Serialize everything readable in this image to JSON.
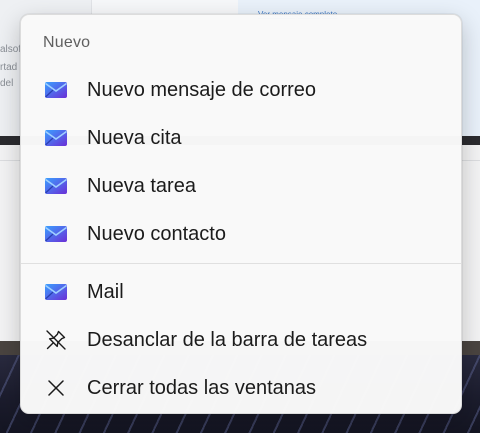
{
  "background": {
    "link_text": "Ver mensaje completo",
    "side_lines": [
      "alsof",
      "rtad",
      "del"
    ]
  },
  "menu": {
    "header": "Nuevo",
    "tasks": [
      {
        "label": "Nuevo mensaje de correo",
        "icon": "mail-app-icon"
      },
      {
        "label": "Nueva cita",
        "icon": "mail-app-icon"
      },
      {
        "label": "Nueva tarea",
        "icon": "mail-app-icon"
      },
      {
        "label": "Nuevo contacto",
        "icon": "mail-app-icon"
      }
    ],
    "app": {
      "label": "Mail",
      "icon": "mail-app-icon"
    },
    "unpin": {
      "label": "Desanclar de la barra de tareas",
      "icon": "unpin-icon"
    },
    "close_all": {
      "label": "Cerrar todas las ventanas",
      "icon": "close-icon"
    }
  },
  "colors": {
    "menu_bg": "#f9f9f9",
    "text": "#1b1b1b",
    "header_text": "#5f5f5f",
    "mail_icon_blue": "#2f6fe4",
    "mail_icon_purple": "#6b2fd6"
  }
}
